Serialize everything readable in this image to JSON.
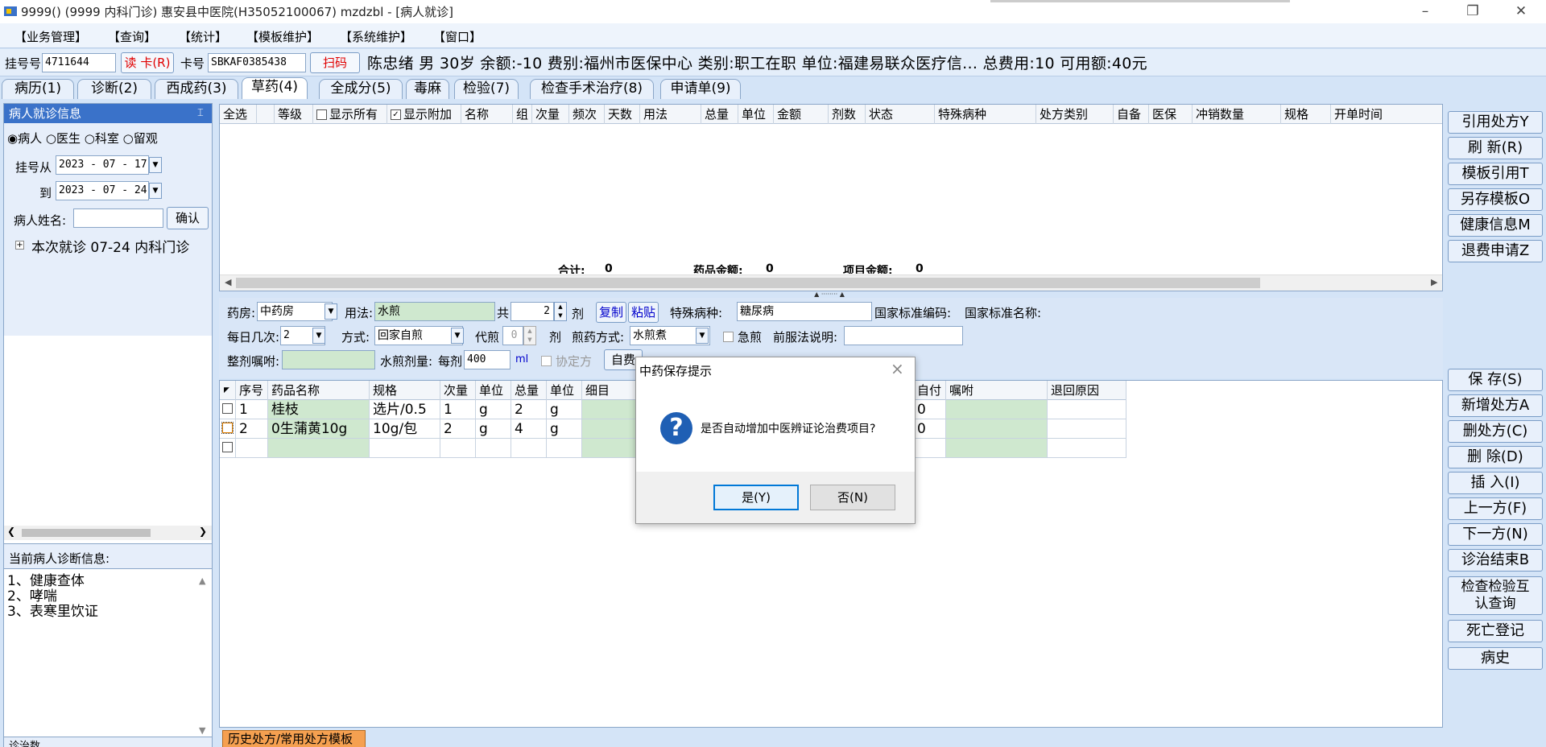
{
  "window": {
    "title": "9999() (9999 内科门诊) 惠安县中医院(H35052100067) mzdzbl - [病人就诊]"
  },
  "menus": [
    "【业务管理】",
    "【查询】",
    "【统计】",
    "【模板维护】",
    "【系统维护】",
    "【窗口】"
  ],
  "registration": {
    "reg_label": "挂号号",
    "reg_value": "4711644",
    "read_card": "读 卡(R)",
    "card_label": "卡号",
    "card_value": "SBKAF0385438",
    "scan": "扫码"
  },
  "patient_line": "陈忠绪 男 30岁 余额:-10 费别:福州市医保中心 类别:职工在职 单位:福建易联众医疗信... 总费用:10 可用额:40元",
  "tabs": [
    "病历(1)",
    "诊断(2)",
    "西成药(3)",
    "草药(4)",
    "全成分(5)",
    "毒麻",
    "检验(7)",
    "检查手术治疗(8)",
    "申请单(9)"
  ],
  "left": {
    "panel_title": "病人就诊信息",
    "radios": [
      "病人",
      "医生",
      "科室",
      "留观"
    ],
    "date_from_label": "挂号从",
    "date_from": "2023 - 07 - 17",
    "date_to_label": "到",
    "date_to": "2023 - 07 - 24",
    "name_label": "病人姓名:",
    "confirm": "确认",
    "tree_item": "本次就诊  07-24  内科门诊",
    "diag_title": "当前病人诊断信息:",
    "diagnoses": [
      "1、健康查体",
      "2、哮喘",
      "3、表寒里饮证"
    ],
    "bottom_cut": "诊治数"
  },
  "top_grid": {
    "headers": [
      "全选",
      "",
      "等级",
      "显示所有",
      "显示附加",
      "名称",
      "组",
      "次量",
      "频次",
      "天数",
      "用法",
      "总量",
      "单位",
      "金额",
      "剂数",
      "状态",
      "特殊病种",
      "处方类别",
      "自备",
      "医保",
      "冲销数量",
      "规格",
      "开单时间"
    ],
    "summary_total_label": "合计:",
    "summary_total": "0",
    "summary_drug_label": "药品金额:",
    "summary_drug": "0",
    "summary_item_label": "项目金额:",
    "summary_item": "0"
  },
  "herb_form": {
    "pharmacy_label": "药房:",
    "pharmacy": "中药房",
    "usage_label": "用法:",
    "usage": "水煎",
    "total_label": "共",
    "doses": "2",
    "dose_unit": "剂",
    "copy": "复制",
    "paste": "粘贴",
    "special_label": "特殊病种:",
    "special": "糖尿病",
    "nat_code_label": "国家标准编码:",
    "nat_name_label": "国家标准名称:",
    "daily_label": "每日几次:",
    "daily": "2",
    "method_label": "方式:",
    "method": "回家自煎",
    "proxy_label": "代煎",
    "proxy": "0",
    "proxy_unit": "剂",
    "decoct_label": "煎药方式:",
    "decoct": "水煎煮",
    "urgent_label": "急煎",
    "pre_label": "前服法说明:",
    "whole_label": "整剂嘱咐:",
    "water_label": "水煎剂量:",
    "per_label": "每剂",
    "per_value": "400",
    "per_unit": "ml",
    "agreement_label": "协定方",
    "selfpay_btn": "自费"
  },
  "herb_grid": {
    "headers": [
      "",
      "序号",
      "药品名称",
      "规格",
      "次量",
      "单位",
      "总量",
      "单位",
      "细目",
      "自付",
      "嘱咐",
      "退回原因"
    ],
    "rows": [
      {
        "no": "1",
        "name": "桂枝",
        "spec": "选片/0.5",
        "dose": "1",
        "unit": "g",
        "total": "2",
        "tunit": "g",
        "selfpay": "0"
      },
      {
        "no": "2",
        "name": "0生蒲黄10g",
        "spec": "10g/包",
        "dose": "2",
        "unit": "g",
        "total": "4",
        "tunit": "g",
        "selfpay": "0"
      }
    ]
  },
  "right_buttons_top": [
    "引用处方Y",
    "刷 新(R)",
    "模板引用T",
    "另存模板O",
    "健康信息M",
    "退费申请Z"
  ],
  "right_buttons_bottom": [
    "保 存(S)",
    "新增处方A",
    "删处方(C)",
    "删 除(D)",
    "插 入(I)",
    "上一方(F)",
    "下一方(N)",
    "诊治结束B",
    "检查检验互认查询",
    "死亡登记",
    "病史"
  ],
  "bottom_tab": "历史处方/常用处方模板",
  "dialog": {
    "title": "中药保存提示",
    "message": "是否自动增加中医辨证论治费项目?",
    "yes": "是(Y)",
    "no": "否(N)"
  },
  "colors": {
    "panel_head": "#3a72c9",
    "highlight": "#cfe8cf",
    "bottom_tab": "#f5a050"
  }
}
